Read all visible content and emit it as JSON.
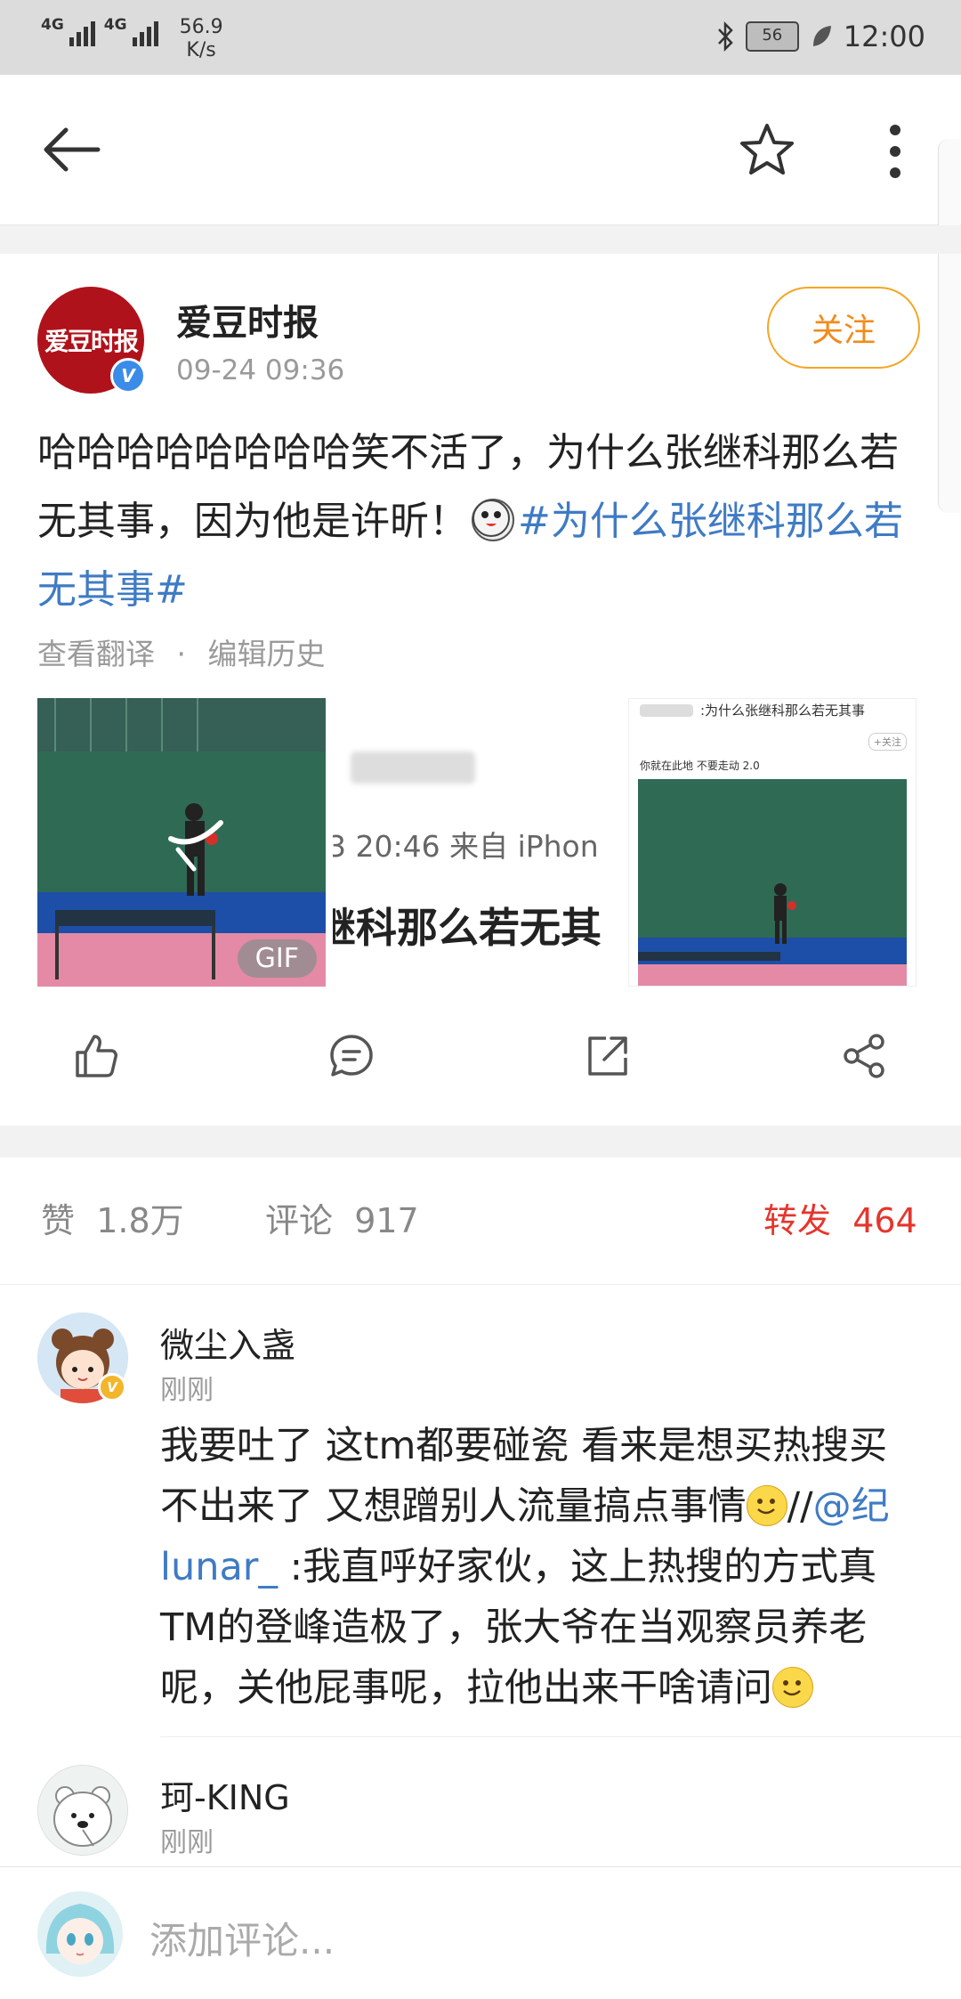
{
  "status_bar": {
    "network1": "4G",
    "network2": "4G",
    "speed_value": "56.9",
    "speed_unit": "K/s",
    "battery": "56",
    "time": "12:00"
  },
  "post": {
    "author": "爱豆时报",
    "avatar_text": "爱豆时报",
    "verified_badge": "V",
    "time": "09-24 09:36",
    "follow_label": "关注",
    "text_before": "哈哈哈哈哈哈哈哈笑不活了，为什么张继科那么若无其事，因为他是许昕！",
    "topic": "#为什么张继科那么若无其事#",
    "translate_link": "查看翻译",
    "separator": "·",
    "history_link": "编辑历史",
    "images": [
      {
        "badge": "GIF"
      },
      {
        "line1": "3 20:46  来自 iPhon",
        "line2": "继科那么若无其"
      },
      {
        "title": ":为什么张继科那么若无其事",
        "follow": "+关注",
        "caption": "你就在此地 不要走动 2.0"
      }
    ]
  },
  "stats": {
    "likes_label": "赞",
    "likes": "1.8万",
    "comments_label": "评论",
    "comments": "917",
    "reposts_label": "转发",
    "reposts": "464"
  },
  "comments": [
    {
      "user": "微尘入盏",
      "time": "刚刚",
      "text1": "我要吐了 这tm都要碰瓷 看来是想买热搜买不出来了 又想蹭别人流量搞点事情",
      "slashes": "//",
      "mention": "@纪lunar_",
      "text2": " :我直呼好家伙，这上热搜的方式真TM的登峰造极了，张大爷在当观察员养老呢，关他屁事呢，拉他出来干啥请问"
    },
    {
      "user": "珂-KING",
      "time": "刚刚"
    }
  ],
  "comment_box": {
    "placeholder": "添加评论..."
  },
  "colors": {
    "accent_orange": "#f28b1a",
    "link_blue": "#3f7bc4",
    "repost_red": "#e5352d",
    "brand_red": "#b0121b"
  }
}
